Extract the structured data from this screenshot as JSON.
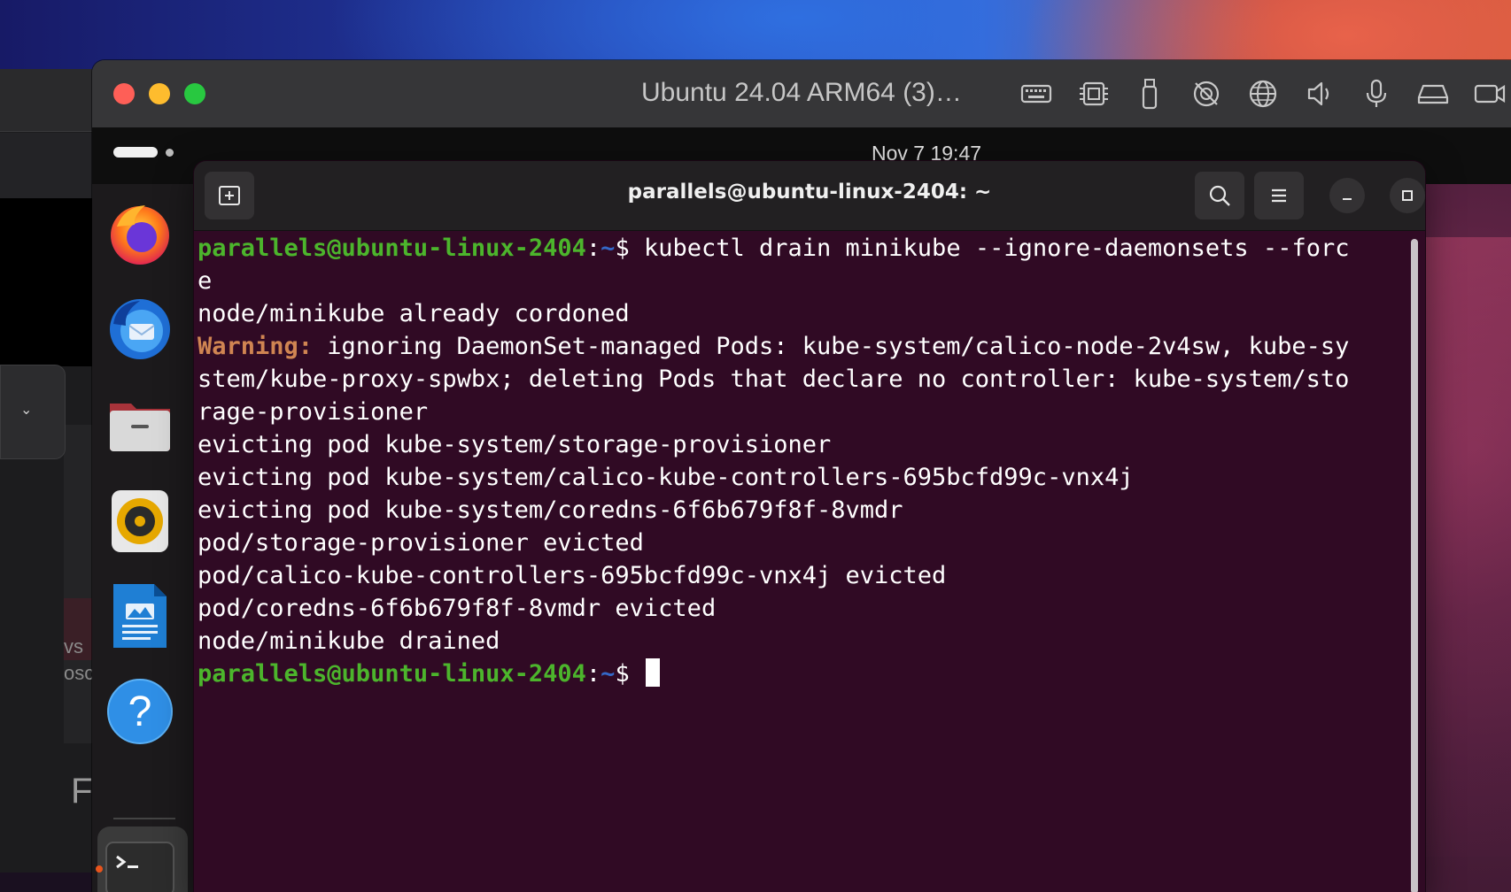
{
  "vm_window": {
    "title": "Ubuntu 24.04 ARM64 (3)…",
    "toolbar_icons": [
      "keyboard-icon",
      "cpu-icon",
      "usb-icon",
      "no-camera-icon",
      "globe-icon",
      "speaker-icon",
      "microphone-icon",
      "drive-icon",
      "video-icon"
    ]
  },
  "ubuntu_topbar": {
    "clock": "Nov 7  19:47"
  },
  "background_window": {
    "text_line1": "vs",
    "text_line2": "osc",
    "text_letter": "F"
  },
  "dock": {
    "items": [
      {
        "name": "Firefox",
        "icon": "firefox-icon"
      },
      {
        "name": "Thunderbird",
        "icon": "thunderbird-icon"
      },
      {
        "name": "Files",
        "icon": "files-icon"
      },
      {
        "name": "Rhythmbox",
        "icon": "rhythmbox-icon"
      },
      {
        "name": "LibreOffice Writer",
        "icon": "writer-icon"
      },
      {
        "name": "Help",
        "icon": "help-icon"
      },
      {
        "name": "Terminal",
        "icon": "terminal-icon"
      }
    ]
  },
  "terminal": {
    "title": "parallels@ubuntu-linux-2404: ~",
    "prompt_user": "parallels@ubuntu-linux-2404",
    "prompt_path": "~",
    "prompt_sep": ":",
    "prompt_dollar": "$ ",
    "command_part1": "kubectl drain minikube --ignore-daemonsets --forc",
    "command_part2": "e",
    "output": {
      "line1": "node/minikube already cordoned",
      "warning_label": "Warning:",
      "warning_rest": " ignoring DaemonSet-managed Pods: kube-system/calico-node-2v4sw, kube-sy",
      "line3": "stem/kube-proxy-spwbx; deleting Pods that declare no controller: kube-system/sto",
      "line4": "rage-provisioner",
      "line5": "evicting pod kube-system/storage-provisioner",
      "line6": "evicting pod kube-system/calico-kube-controllers-695bcfd99c-vnx4j",
      "line7": "evicting pod kube-system/coredns-6f6b679f8f-8vmdr",
      "line8": "pod/storage-provisioner evicted",
      "line9": "pod/calico-kube-controllers-695bcfd99c-vnx4j evicted",
      "line10": "pod/coredns-6f6b679f8f-8vmdr evicted",
      "line11": "node/minikube drained"
    }
  }
}
